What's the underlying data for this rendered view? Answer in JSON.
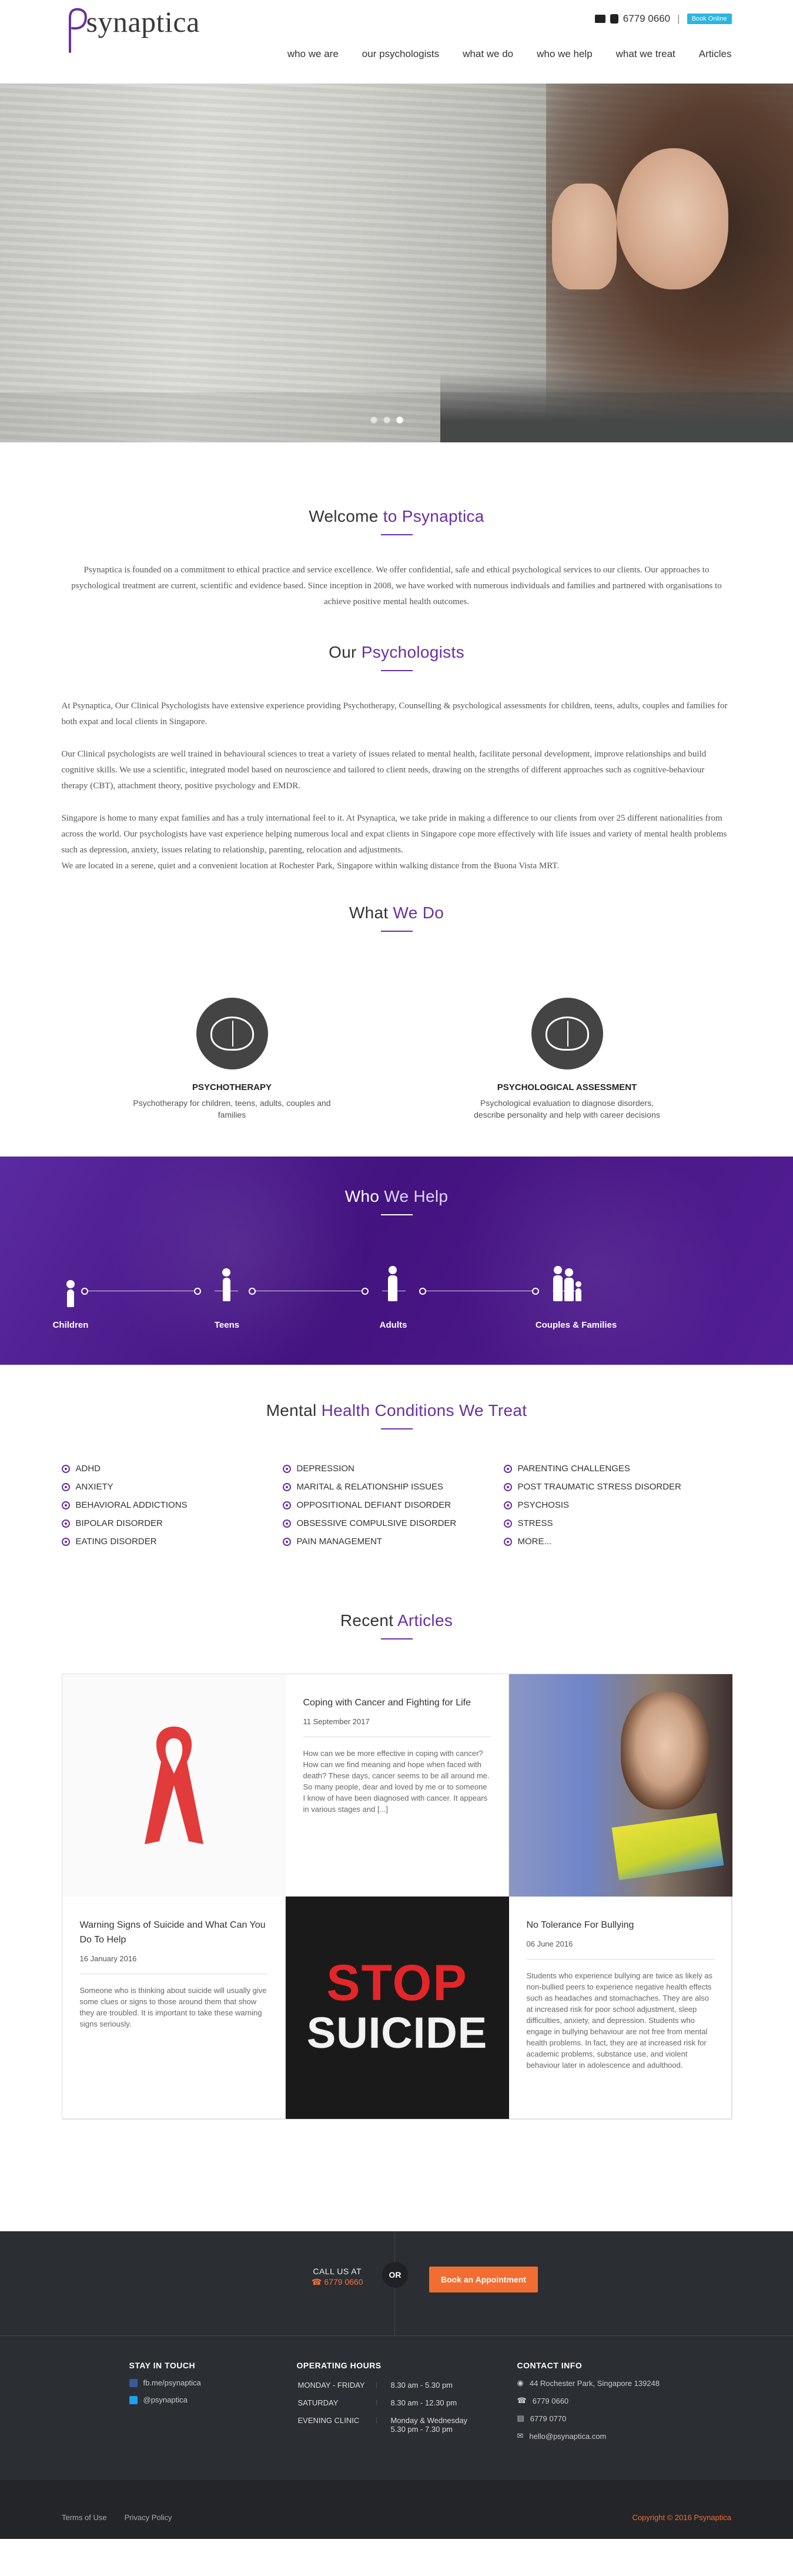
{
  "header": {
    "logo_text": "synaptica",
    "phone": "6779 0660",
    "separator": "|",
    "book_label": "Book Online",
    "nav": [
      "who we are",
      "our psychologists",
      "what we do",
      "who we help",
      "what we treat",
      "Articles"
    ]
  },
  "welcome": {
    "title_a": "Welcome",
    "title_b": "to Psynaptica",
    "text": "Psynaptica is founded on a commitment to ethical practice and service excellence. We offer confidential, safe and ethical psychological services to our clients. Our approaches to psychological treatment are current, scientific and evidence based. Since inception in 2008, we have worked with numerous individuals and families and partnered with organisations to achieve positive mental health outcomes."
  },
  "psychologists": {
    "title_a": "Our",
    "title_b": "Psychologists",
    "p1": "At Psynaptica, Our Clinical Psychologists have extensive experience providing Psychotherapy, Counselling & psychological assessments for children, teens, adults, couples and families for both expat and local clients in Singapore.",
    "p2": "Our Clinical psychologists are well trained in behavioural sciences to treat a variety of issues related to mental health, facilitate personal development, improve relationships and build cognitive skills. We use a scientific, integrated model based on neuroscience and tailored to client needs, drawing on the strengths of different approaches such as cognitive-behaviour therapy (CBT), attachment theory, positive psychology and EMDR.",
    "p3": "Singapore is home to many expat families and has a truly international feel to it.  At Psynaptica, we take pride in making a difference to our clients from over 25 different nationalities from across the world.  Our psychologists have vast experience helping numerous local and expat clients in Singapore cope more effectively with life issues and variety of mental health problems such as depression, anxiety, issues relating to relationship, parenting, relocation and adjustments.",
    "p4": "We are located in a serene, quiet and a convenient location at Rochester Park, Singapore within walking distance from the Buona Vista MRT."
  },
  "whatwedo": {
    "title_a": "What",
    "title_b": "We Do",
    "services": [
      {
        "title": "PSYCHOTHERAPY",
        "desc": "Psychotherapy for children, teens, adults, couples and families"
      },
      {
        "title": "PSYCHOLOGICAL ASSESSMENT",
        "desc": "Psychological evaluation to diagnose disorders, describe personality and help with career decisions"
      }
    ]
  },
  "whowehelp": {
    "title_a": "Who",
    "title_b": "We Help",
    "groups": [
      "Children",
      "Teens",
      "Adults",
      "Couples & Families"
    ]
  },
  "conditions": {
    "title_a": "Mental",
    "title_b": "Health Conditions We Treat",
    "col1": [
      "ADHD",
      "ANXIETY",
      "BEHAVIORAL ADDICTIONS",
      "BIPOLAR DISORDER",
      "EATING DISORDER"
    ],
    "col2": [
      "DEPRESSION",
      "MARITAL & RELATIONSHIP ISSUES",
      "OPPOSITIONAL DEFIANT DISORDER",
      "OBSESSIVE COMPULSIVE DISORDER",
      "PAIN MANAGEMENT"
    ],
    "col3": [
      "PARENTING CHALLENGES",
      "POST TRAUMATIC STRESS DISORDER",
      "PSYCHOSIS",
      "STRESS",
      "MORE..."
    ]
  },
  "articles": {
    "title_a": "Recent",
    "title_b": "Articles",
    "items": [
      {
        "title": "Coping with Cancer and Fighting for Life",
        "date": "11 September 2017",
        "excerpt": "How can we be more effective in coping with cancer? How can we find meaning and hope when faced with death? These days, cancer seems to be all around me. So many people, dear and loved by me or to someone I know of have been diagnosed with cancer. It appears in various stages and [...]"
      },
      {
        "title": "Warning Signs of Suicide and What Can You Do To Help",
        "date": "16 January 2016",
        "excerpt": "Someone who is thinking about suicide will usually give some clues or signs to those around them that show they are troubled. It is important to take these warning signs seriously."
      },
      {
        "title": "No Tolerance For Bullying",
        "date": "06 June 2016",
        "excerpt": "Students who experience bullying are twice as likely as non-bullied peers to experience negative health effects such as headaches and stomachaches. They are also at increased risk for poor school adjustment, sleep difficulties, anxiety, and depression. Students who engage in bullying behaviour are not free from mental health problems. In fact, they are at increased risk for academic problems, substance use, and violent behaviour later in adolescence and adulthood."
      }
    ],
    "stop_text": "STOP",
    "suicide_text": "SUICIDE"
  },
  "footer": {
    "call_label": "CALL US AT",
    "call_number": "6779 0660",
    "or": "OR",
    "appointment": "Book an Appointment",
    "stay_title": "STAY IN TOUCH",
    "facebook": "fb.me/psynaptica",
    "twitter": "@psynaptica",
    "hours_title": "OPERATING HOURS",
    "hours": [
      {
        "day": "MONDAY - FRIDAY",
        "time": "8.30 am - 5.30 pm"
      },
      {
        "day": "SATURDAY",
        "time": "8.30 am - 12.30 pm"
      },
      {
        "day": "EVENING CLINIC",
        "time": "Monday & Wednesday",
        "time2": "5.30 pm - 7.30 pm"
      }
    ],
    "contact_title": "CONTACT INFO",
    "address": "44 Rochester Park, Singapore 139248",
    "phone": "6779 0660",
    "fax": "6779 0770",
    "email": "hello@psynaptica.com",
    "terms": "Terms of Use",
    "privacy": "Privacy Policy",
    "copyright": "Copyright © 2016 Psynaptica"
  },
  "colors": {
    "brand_purple": "#6a2fa1",
    "accent_orange": "#f26d31",
    "book_blue": "#2bb5e0",
    "footer_bg": "#2b2e33"
  }
}
